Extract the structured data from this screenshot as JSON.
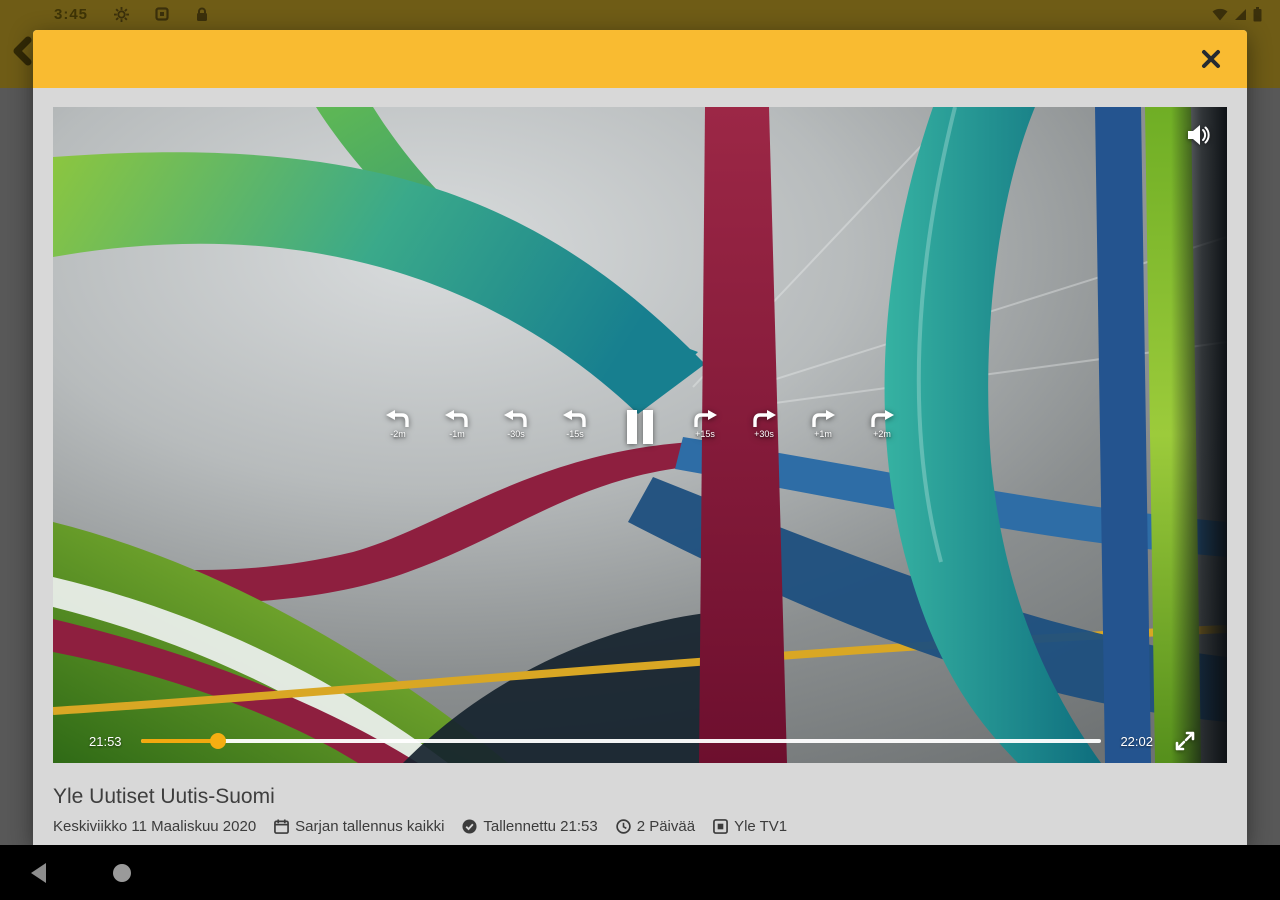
{
  "status_bar": {
    "time": "3:45",
    "left_icons": [
      "gear",
      "screenshot",
      "lock"
    ],
    "right_icons": [
      "wifi",
      "cellular",
      "battery"
    ]
  },
  "background_app": {
    "back_icon": "chevron-left"
  },
  "modal": {
    "header": {
      "close_icon": "x"
    },
    "player": {
      "volume_icon": "speaker",
      "state_icon": "pause",
      "fullscreen_icon": "expand-arrows",
      "rewind_labels": [
        "-2m",
        "-1m",
        "-30s",
        "-15s"
      ],
      "forward_labels": [
        "+15s",
        "+30s",
        "+1m",
        "+2m"
      ],
      "current_time": "21:53",
      "end_time": "22:02",
      "progress_percent": 8
    },
    "details": {
      "title": "Yle Uutiset Uutis-Suomi",
      "date": "Keskiviikko 11 Maaliskuu 2020",
      "series": "Sarjan tallennus kaikki",
      "recorded": "Tallennettu 21:53",
      "retention": "2 Päivää",
      "channel": "Yle TV1"
    }
  },
  "nav_bar": {
    "buttons": [
      "back",
      "home"
    ]
  },
  "colors": {
    "accent_yellow": "#f9bb31",
    "progress_yellow": "#f2a90f",
    "dim_gray": "#585858",
    "status_olive": "#6f5c16"
  }
}
